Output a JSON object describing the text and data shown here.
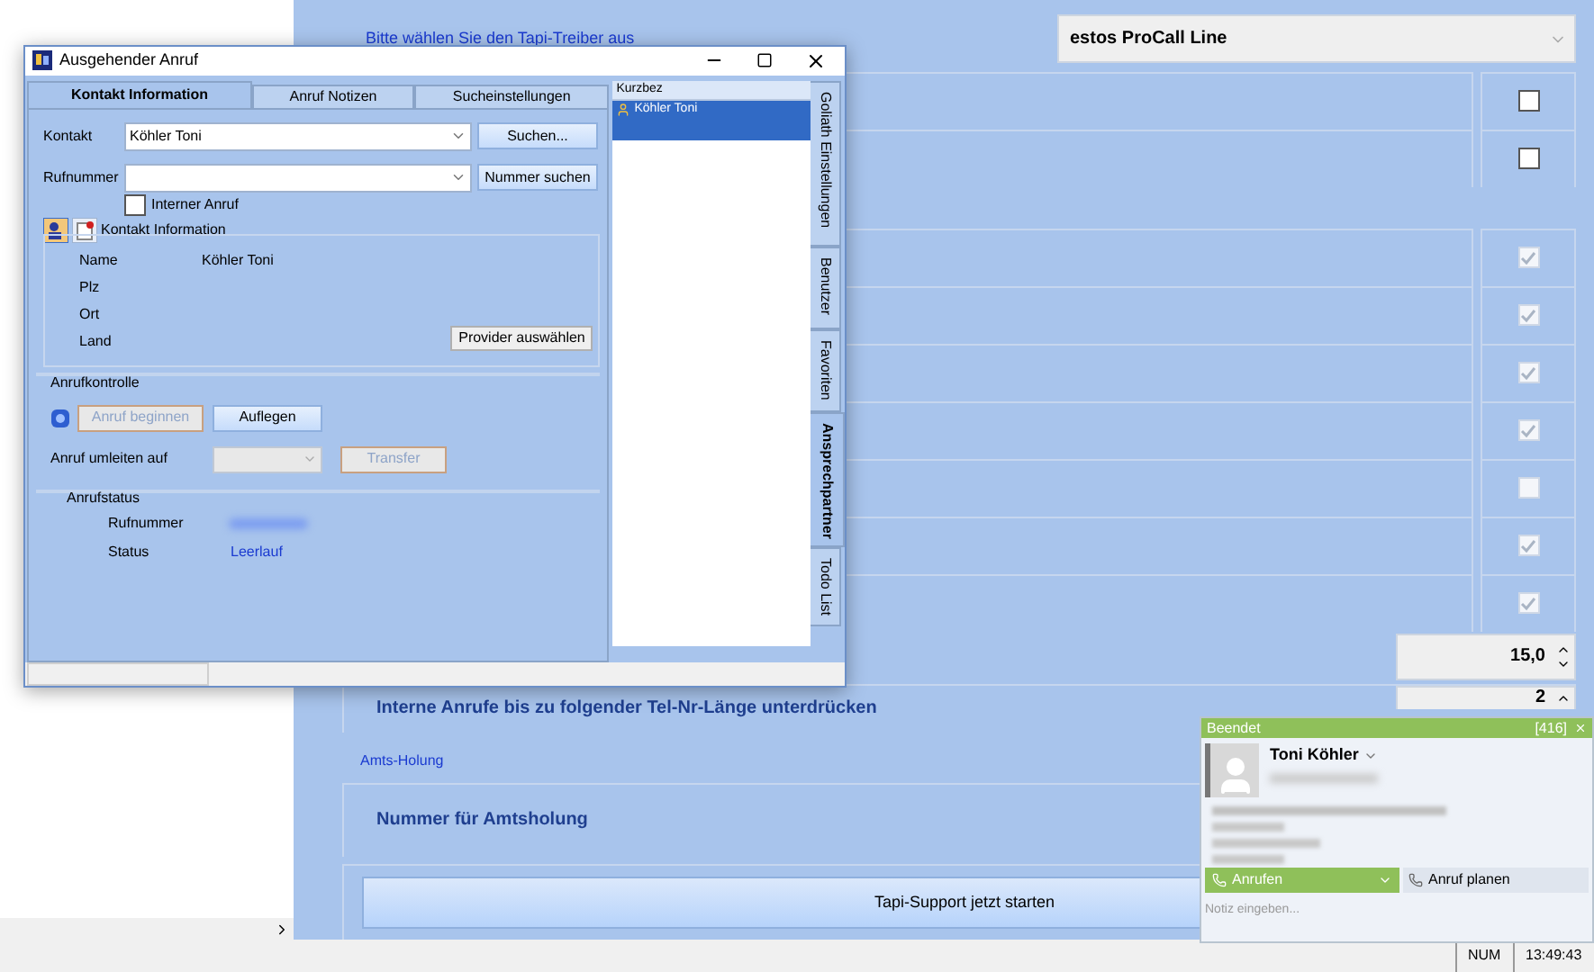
{
  "main": {
    "tapi_hint": "Bitte wählen Sie  den Tapi-Treiber aus",
    "tapi_driver": "estos ProCall Line",
    "option_groups": [
      [
        {
          "checked": false
        },
        {
          "checked": false
        }
      ],
      [
        {
          "checked": true
        },
        {
          "checked": true
        },
        {
          "checked": true
        },
        {
          "checked": true
        },
        {
          "checked": false
        },
        {
          "checked": true
        },
        {
          "checked": true
        }
      ]
    ],
    "spin_fields": [
      {
        "value": "15,0"
      },
      {
        "value": "2"
      }
    ],
    "suppress_label": "Interne Anrufe bis zu folgender Tel-Nr-Länge unterdrücken",
    "amts_section": "Amts-Holung",
    "amts_label": "Nummer für Amtsholung",
    "start_button": "Tapi-Support jetzt starten"
  },
  "status_bar": [
    "NUM",
    "13:49:43"
  ],
  "dialog": {
    "title": "Ausgehender Anruf",
    "tabs": [
      {
        "label": "Kontakt Information",
        "selected": true
      },
      {
        "label": "Anruf Notizen",
        "selected": false
      },
      {
        "label": "Sucheinstellungen",
        "selected": false
      }
    ],
    "contact": {
      "label": "Kontakt",
      "value": "Köhler Toni",
      "button": "Suchen..."
    },
    "number": {
      "label": "Rufnummer",
      "button": "Nummer suchen"
    },
    "internal_call": {
      "label": "Interner Anruf",
      "checked": false
    },
    "contact_info": {
      "title": "Kontakt Information",
      "rows": [
        {
          "label": "Name",
          "value": "Köhler Toni"
        },
        {
          "label": "Plz"
        },
        {
          "label": "Ort"
        },
        {
          "label": "Land"
        }
      ],
      "button": "Provider auswählen"
    },
    "call_control": {
      "title": "Anrufkontrolle",
      "start": {
        "label": "Anruf beginnen",
        "disabled": true
      },
      "hangup": {
        "label": "Auflegen",
        "disabled": false
      },
      "redirect_label": "Anruf umleiten auf",
      "transfer": {
        "label": "Transfer",
        "disabled": true
      }
    },
    "call_status": {
      "title": "Anrufstatus",
      "number_label": "Rufnummer",
      "status_label": "Status",
      "status": "Leerlauf"
    },
    "list": {
      "header": "Kurzbez",
      "items": [
        {
          "label": "Köhler Toni",
          "selected": true
        }
      ]
    },
    "side_tabs": [
      {
        "label": "Goliath Einstellungen",
        "selected": false
      },
      {
        "label": "Benutzer",
        "selected": false
      },
      {
        "label": "Favoriten",
        "selected": false
      },
      {
        "label": "Ansprechpartner",
        "selected": true
      },
      {
        "label": "Todo List",
        "selected": false
      }
    ]
  },
  "call_popup": {
    "state": "Beendet",
    "count": "[416]",
    "name": "Toni Köhler",
    "call_button": "Anrufen",
    "plan_button": "Anruf planen",
    "note_placeholder": "Notiz eingeben..."
  }
}
